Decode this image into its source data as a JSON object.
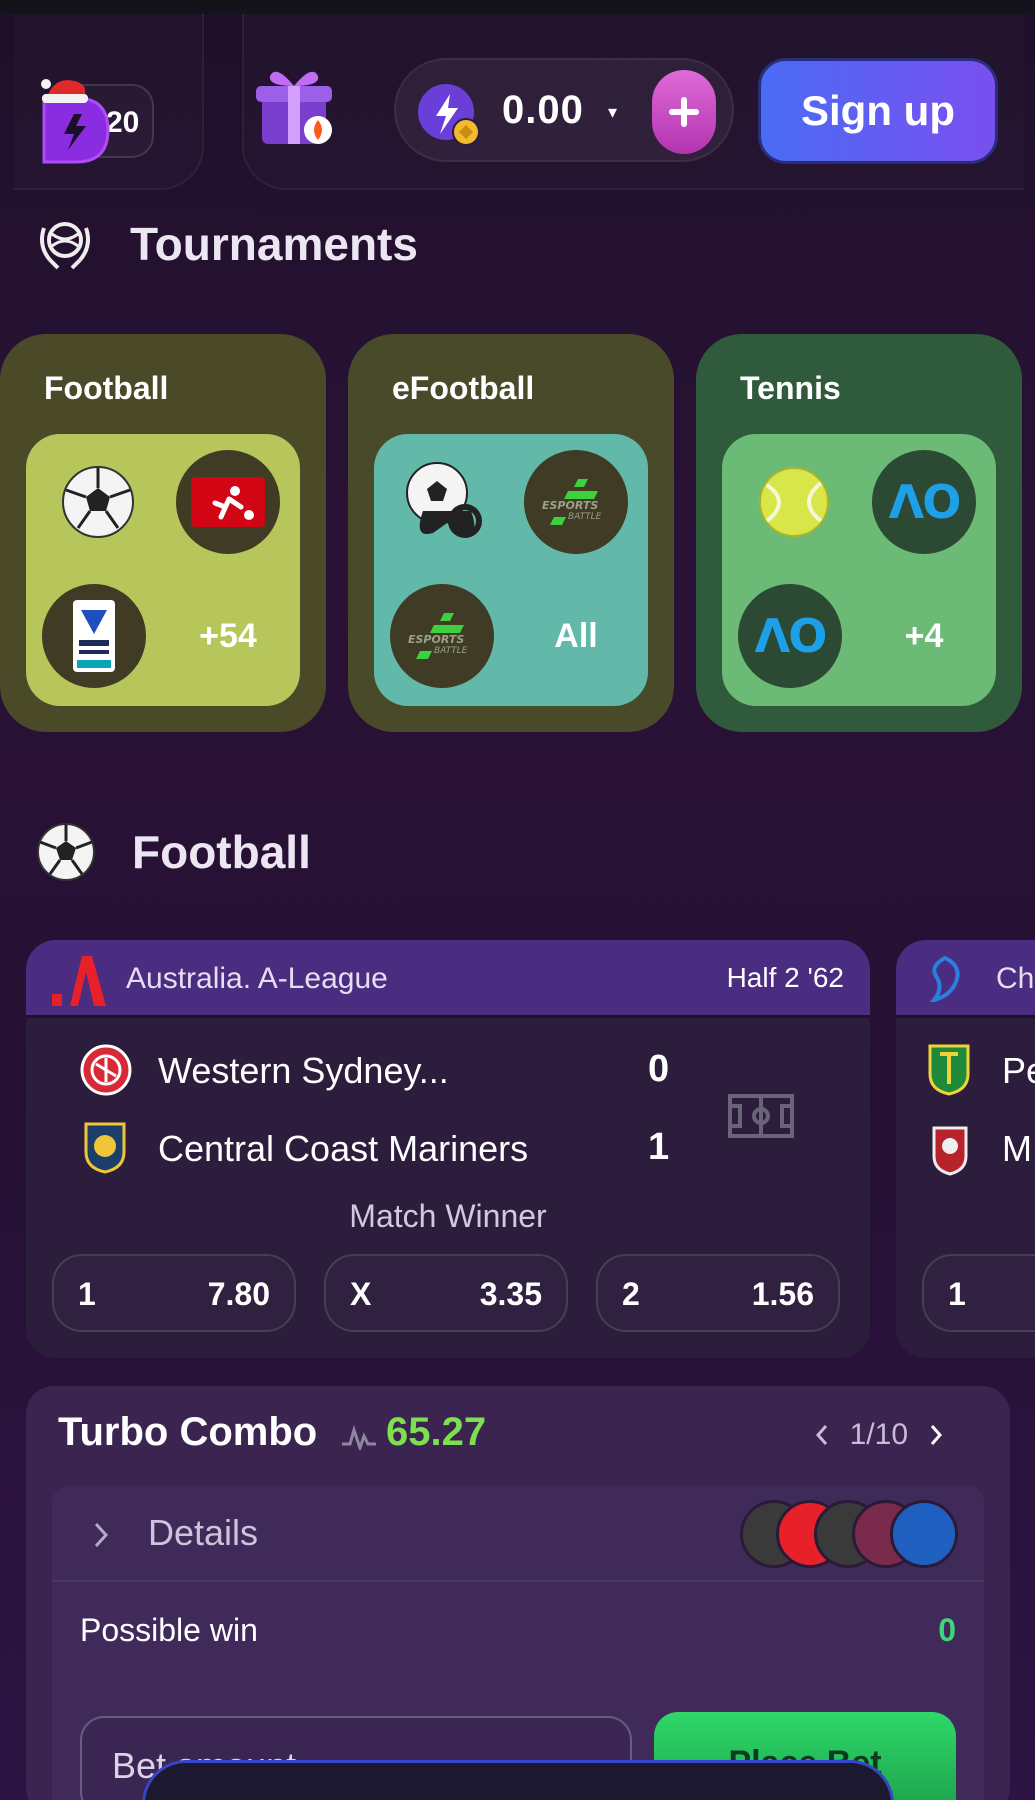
{
  "header": {
    "logo_badge": "20",
    "balance": "0.00",
    "balance_caret": "▾",
    "signup_label": "Sign up"
  },
  "tournaments": {
    "title": "Tournaments",
    "cards": [
      {
        "label": "Football",
        "more": "+54",
        "color": "#4a4a28",
        "inner": "#b6c65a"
      },
      {
        "label": "eFootball",
        "more": "All",
        "color": "#494a2a",
        "inner": "#62b8a9"
      },
      {
        "label": "Tennis",
        "more": "+4",
        "color": "#2f5b3c",
        "inner": "#6bbb76"
      }
    ]
  },
  "football": {
    "title": "Football",
    "match": {
      "league": "Australia. A-League",
      "time": "Half 2 '62",
      "home": {
        "name": "Western Sydney...",
        "score": "0"
      },
      "away": {
        "name": "Central Coast Mariners",
        "score": "1"
      },
      "market": "Match Winner",
      "odds": [
        {
          "key": "1",
          "value": "7.80"
        },
        {
          "key": "X",
          "value": "3.35"
        },
        {
          "key": "2",
          "value": "1.56"
        }
      ]
    },
    "match2": {
      "league_partial": "Ch",
      "home_partial": "Pe",
      "away_partial": "M",
      "odd_key": "1"
    }
  },
  "turbo_combo": {
    "title": "Turbo Combo",
    "value": "65.27",
    "page": "1/10",
    "details_label": "Details",
    "possible_win_label": "Possible win",
    "possible_win_value": "0",
    "bet_placeholder": "Bet amount",
    "place_bet_label": "Place Bet"
  },
  "colors": {
    "accent_purple": "#7a4ff0",
    "accent_green": "#2fd86a",
    "turbo_value": "#7de04e"
  }
}
